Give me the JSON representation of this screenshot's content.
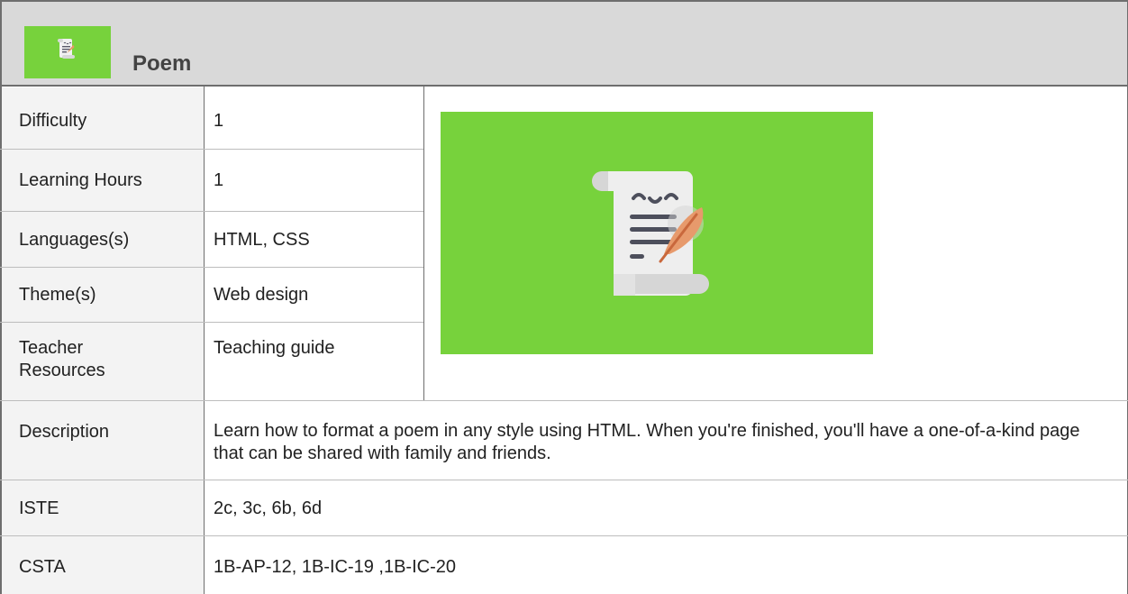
{
  "header": {
    "title": "Poem",
    "icon": "poem-scroll-icon",
    "accent": "#77d23c"
  },
  "rows": {
    "difficulty": {
      "label": "Difficulty",
      "value": "1"
    },
    "learning_hours": {
      "label": "Learning Hours",
      "value": "1"
    },
    "languages": {
      "label": "Languages(s)",
      "value": "HTML, CSS"
    },
    "themes": {
      "label": "Theme(s)",
      "value": "Web design"
    },
    "teacher_resources": {
      "label": "Teacher Resources",
      "value": "Teaching guide"
    },
    "description": {
      "label": "Description",
      "value": "Learn how to format a poem in any style using HTML. When you're finished, you'll have a one-of-a-kind page that can be shared with family and friends."
    },
    "iste": {
      "label": "ISTE",
      "value": "2c, 3c, 6b, 6d"
    },
    "csta": {
      "label": "CSTA",
      "value": "1B-AP-12, 1B-IC-19 ,1B-IC-20"
    }
  },
  "illustration": {
    "icon": "poem-scroll-with-quill-icon",
    "background": "#77d23c"
  }
}
